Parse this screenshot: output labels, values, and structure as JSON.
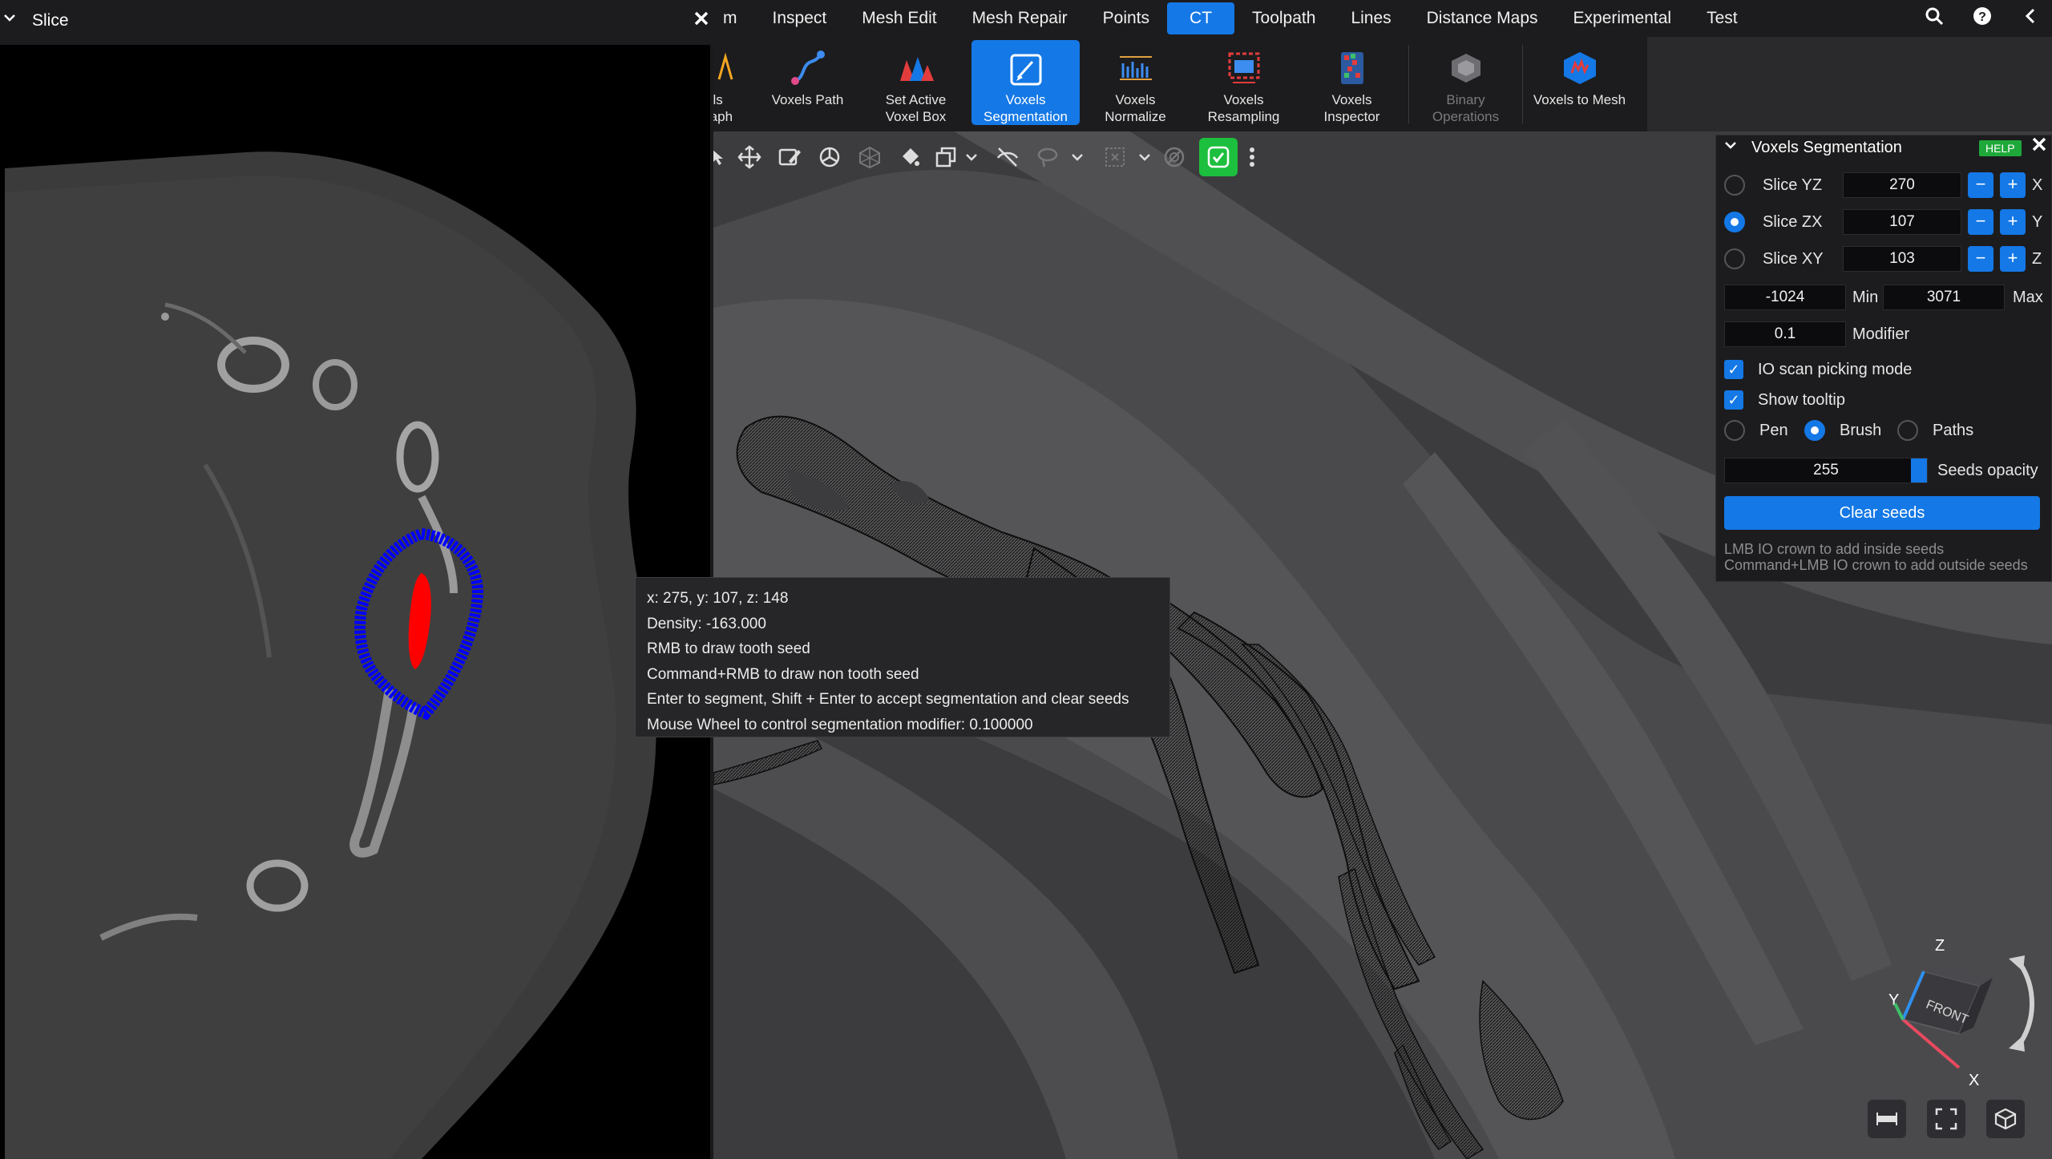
{
  "menu": {
    "items": [
      {
        "label": "m"
      },
      {
        "label": "Inspect"
      },
      {
        "label": "Mesh Edit"
      },
      {
        "label": "Mesh Repair"
      },
      {
        "label": "Points"
      },
      {
        "label": "CT",
        "active": true
      },
      {
        "label": "Toolpath"
      },
      {
        "label": "Lines"
      },
      {
        "label": "Distance Maps"
      },
      {
        "label": "Experimental"
      },
      {
        "label": "Test"
      }
    ],
    "right_icons": [
      "search-icon",
      "help-icon",
      "collapse-left-icon"
    ]
  },
  "ribbon": {
    "partial_label_1": "els",
    "partial_label_2": "raph",
    "voxels_path": "Voxels Path",
    "set_active_voxel_box_1": "Set Active",
    "set_active_voxel_box_2": "Voxel Box",
    "voxels_segmentation_1": "Voxels",
    "voxels_segmentation_2": "Segmentation",
    "voxels_normalize_1": "Voxels",
    "voxels_normalize_2": "Normalize",
    "voxels_resampling_1": "Voxels",
    "voxels_resampling_2": "Resampling",
    "voxels_inspector_1": "Voxels",
    "voxels_inspector_2": "Inspector",
    "binary_operations_1": "Binary",
    "binary_operations_2": "Operations",
    "voxels_to_mesh": "Voxels to Mesh"
  },
  "slice_panel": {
    "title": "Slice"
  },
  "tooltip": {
    "line1": "x: 275, y: 107, z: 148",
    "line2": "Density: -163.000",
    "line3": "RMB to draw tooth seed",
    "line4": "Command+RMB to draw non tooth seed",
    "line5": "Enter to segment, Shift + Enter to accept segmentation and clear seeds",
    "line6": "Mouse Wheel to control segmentation modifier: 0.100000"
  },
  "voxels_segmentation": {
    "title": "Voxels Segmentation",
    "help": "HELP",
    "slices": [
      {
        "label": "Slice YZ",
        "value": "270",
        "axis": "X",
        "selected": false
      },
      {
        "label": "Slice ZX",
        "value": "107",
        "axis": "Y",
        "selected": true
      },
      {
        "label": "Slice XY",
        "value": "103",
        "axis": "Z",
        "selected": false
      }
    ],
    "min_value": "-1024",
    "min_label": "Min",
    "max_value": "3071",
    "max_label": "Max",
    "modifier_value": "0.1",
    "modifier_label": "Modifier",
    "io_scan_picking": "IO scan picking mode",
    "show_tooltip": "Show tooltip",
    "pen": "Pen",
    "brush": "Brush",
    "paths": "Paths",
    "seeds_opacity_value": "255",
    "seeds_opacity_label": "Seeds opacity",
    "clear_seeds": "Clear seeds",
    "hint1": "LMB IO crown to add inside seeds",
    "hint2": "Command+LMB IO crown to add outside seeds"
  },
  "gizmo": {
    "z": "Z",
    "y": "Y",
    "x": "X",
    "front": "FRONT"
  },
  "colors": {
    "accent": "#1478e6",
    "ok_green": "#1dbf3e",
    "help_green": "#1fa83a",
    "seed_red": "#ff0000",
    "seed_blue": "#0000ff"
  }
}
